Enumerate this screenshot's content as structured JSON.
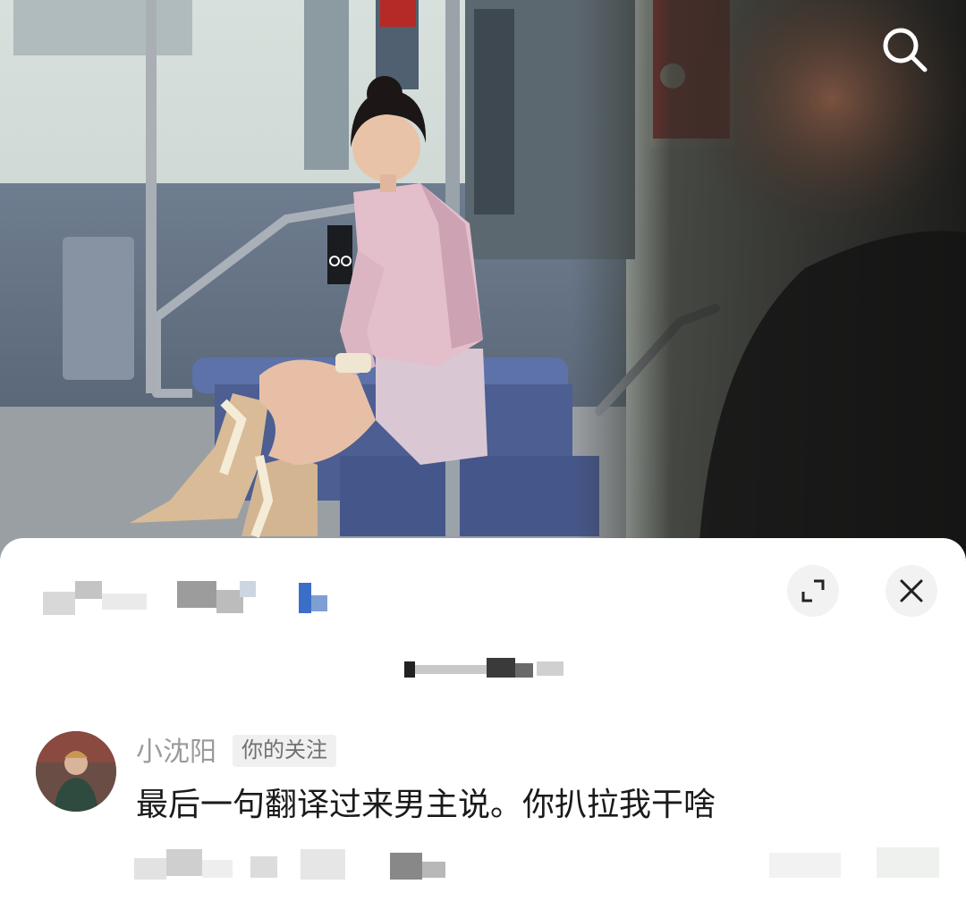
{
  "search": {
    "icon": "search-icon"
  },
  "sheet": {
    "expand_icon": "expand-icon",
    "close_icon": "close-icon"
  },
  "comment": {
    "username": "小沈阳",
    "badge": "你的关注",
    "text": "最后一句翻译过来男主说。你扒拉我干啥"
  },
  "colors": {
    "sheet_bg": "#ffffff",
    "button_bg": "#f2f2f2",
    "username": "#9a9a9a",
    "comment_text": "#1a1a1a"
  }
}
